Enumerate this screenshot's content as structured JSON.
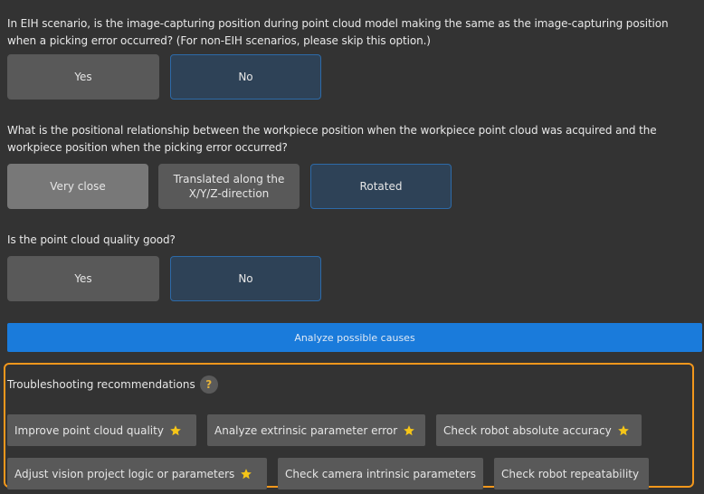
{
  "questions": [
    {
      "text": "In EIH scenario, is the image-capturing position during point cloud model making the same as the image-capturing position when a picking error occurred? (For non-EIH scenarios, please skip this option.)",
      "options": [
        {
          "label": "Yes",
          "state": "normal"
        },
        {
          "label": "No",
          "state": "selected"
        }
      ]
    },
    {
      "text": "What is the positional relationship between the workpiece position when the workpiece point cloud was acquired and the workpiece position when the picking error occurred?",
      "options": [
        {
          "label": "Very close",
          "state": "hover"
        },
        {
          "label": "Translated along the X/Y/Z-direction",
          "state": "normal"
        },
        {
          "label": "Rotated",
          "state": "selected"
        }
      ]
    },
    {
      "text": "Is the point cloud quality good?",
      "options": [
        {
          "label": "Yes",
          "state": "normal"
        },
        {
          "label": "No",
          "state": "selected"
        }
      ]
    }
  ],
  "analyze_button": {
    "label": "Analyze possible causes"
  },
  "recommendations": {
    "title": "Troubleshooting recommendations",
    "help_icon": "?",
    "items": [
      {
        "label": "Improve point cloud quality",
        "starred": true
      },
      {
        "label": "Analyze extrinsic parameter error",
        "starred": true
      },
      {
        "label": "Check robot absolute accuracy",
        "starred": true
      },
      {
        "label": "Adjust vision project logic or parameters",
        "starred": true
      },
      {
        "label": "Check camera intrinsic parameters",
        "starred": false
      },
      {
        "label": "Check robot repeatability",
        "starred": false
      }
    ]
  },
  "colors": {
    "background": "#333333",
    "button_normal": "#595959",
    "button_hover": "#787878",
    "button_selected": "#2e4257",
    "button_selected_border": "#2d6aa8",
    "primary": "#1a7bdb",
    "panel_border": "#f2971c",
    "star": "#f5c518"
  }
}
